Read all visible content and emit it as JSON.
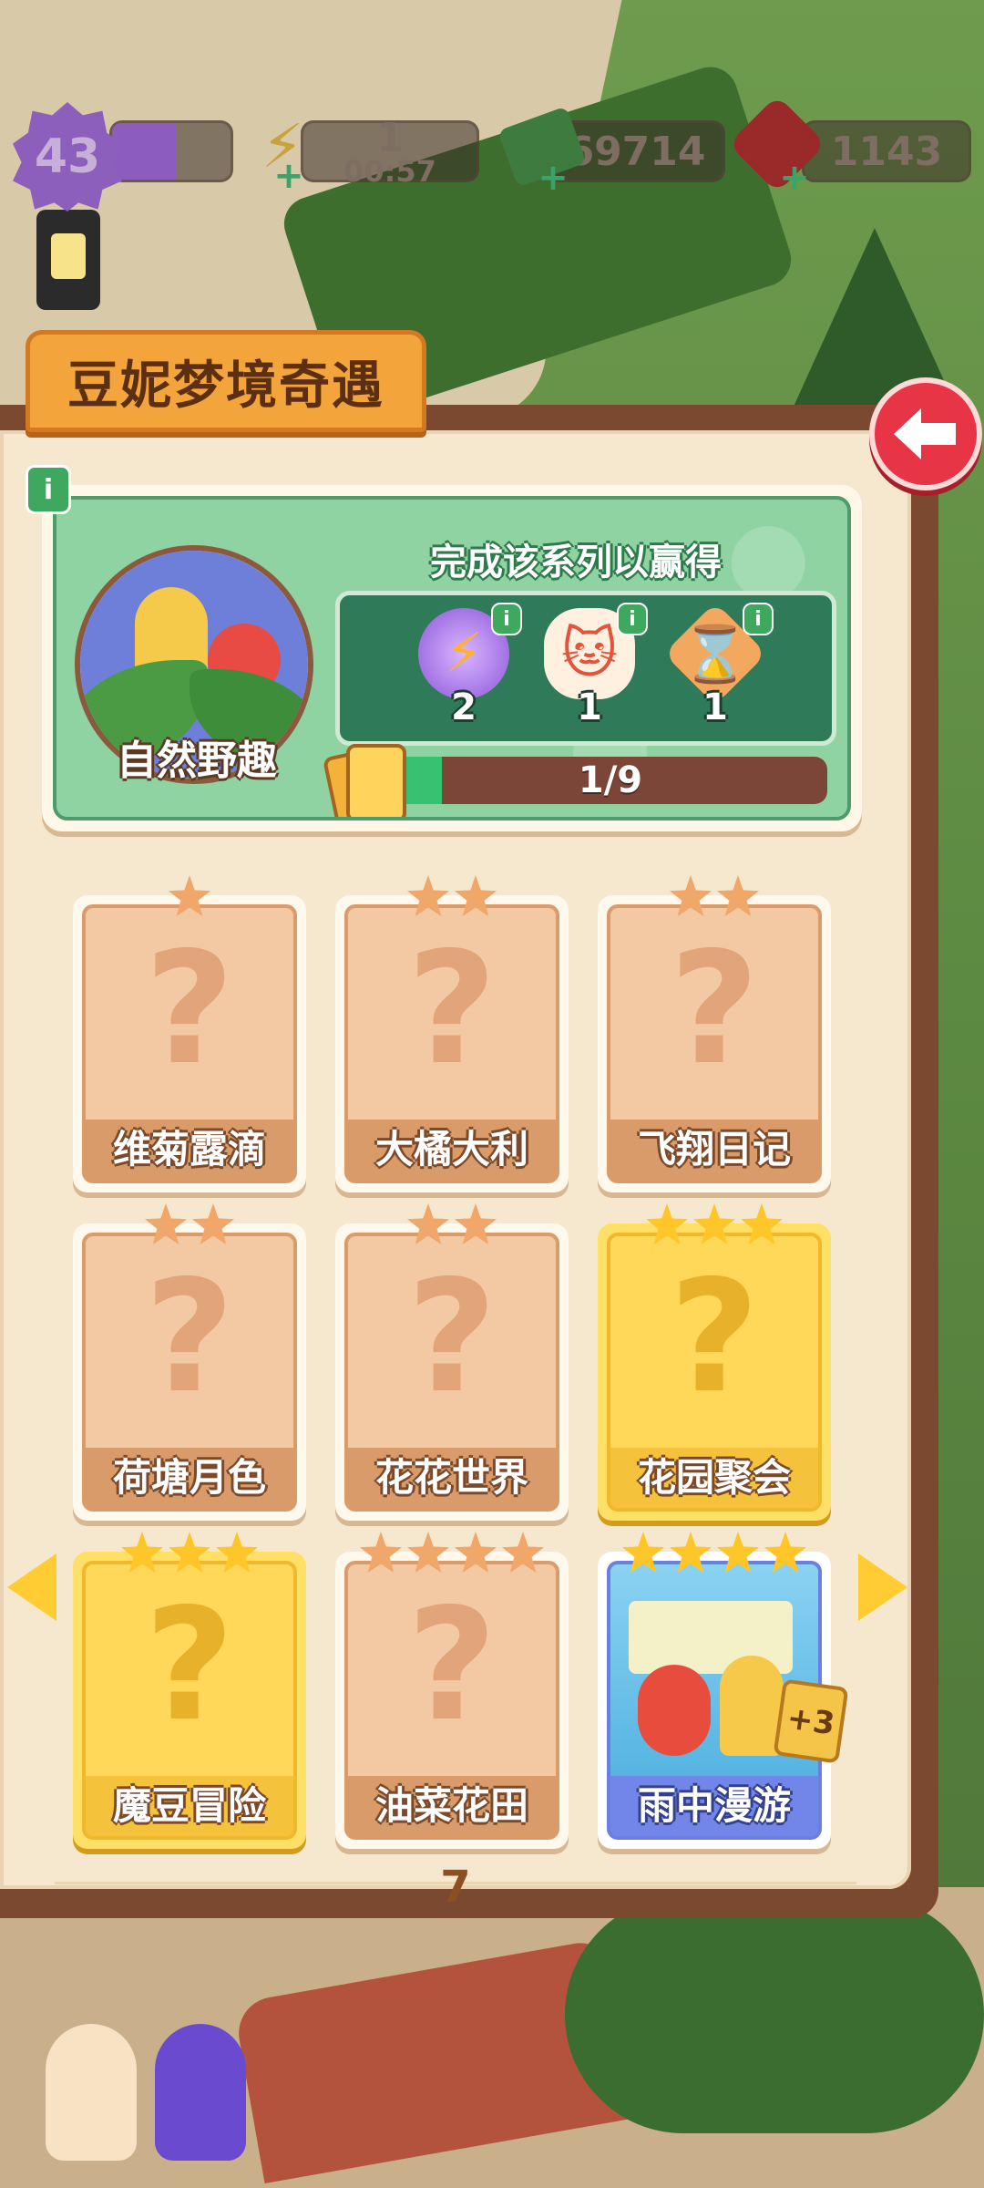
{
  "hud": {
    "level": "43",
    "xp_fraction": 0.55,
    "energy": "1",
    "energy_timer": "00:57",
    "cash": "69714",
    "gems": "1143"
  },
  "title": "豆妮梦境奇遇",
  "series": {
    "name": "自然野趣",
    "reward_heading": "完成该系列以赢得",
    "rewards": [
      {
        "icon": "lightning-orb-icon",
        "count": "2"
      },
      {
        "icon": "lucky-cat-icon",
        "count": "1"
      },
      {
        "icon": "hourglass-badge-icon",
        "count": "1"
      }
    ],
    "progress_text": "1/9",
    "progress_fraction": 0.111
  },
  "cards": [
    {
      "name": "维菊露滴",
      "stars": 1,
      "style": "locked"
    },
    {
      "name": "大橘大利",
      "stars": 2,
      "style": "locked"
    },
    {
      "name": "飞翔日记",
      "stars": 2,
      "style": "locked"
    },
    {
      "name": "荷塘月色",
      "stars": 2,
      "style": "locked"
    },
    {
      "name": "花花世界",
      "stars": 2,
      "style": "locked"
    },
    {
      "name": "花园聚会",
      "stars": 3,
      "style": "gold"
    },
    {
      "name": "魔豆冒险",
      "stars": 3,
      "style": "gold"
    },
    {
      "name": "油菜花田",
      "stars": 4,
      "style": "locked"
    },
    {
      "name": "雨中漫游",
      "stars": 4,
      "style": "collected",
      "badge": "+3"
    }
  ],
  "page_number": "7",
  "colors": {
    "banner": "#f3a43b",
    "progress": "#39c172",
    "gold_card": "#ffd85a",
    "locked_card": "#f3c9a4",
    "back_button": "#e83545"
  }
}
